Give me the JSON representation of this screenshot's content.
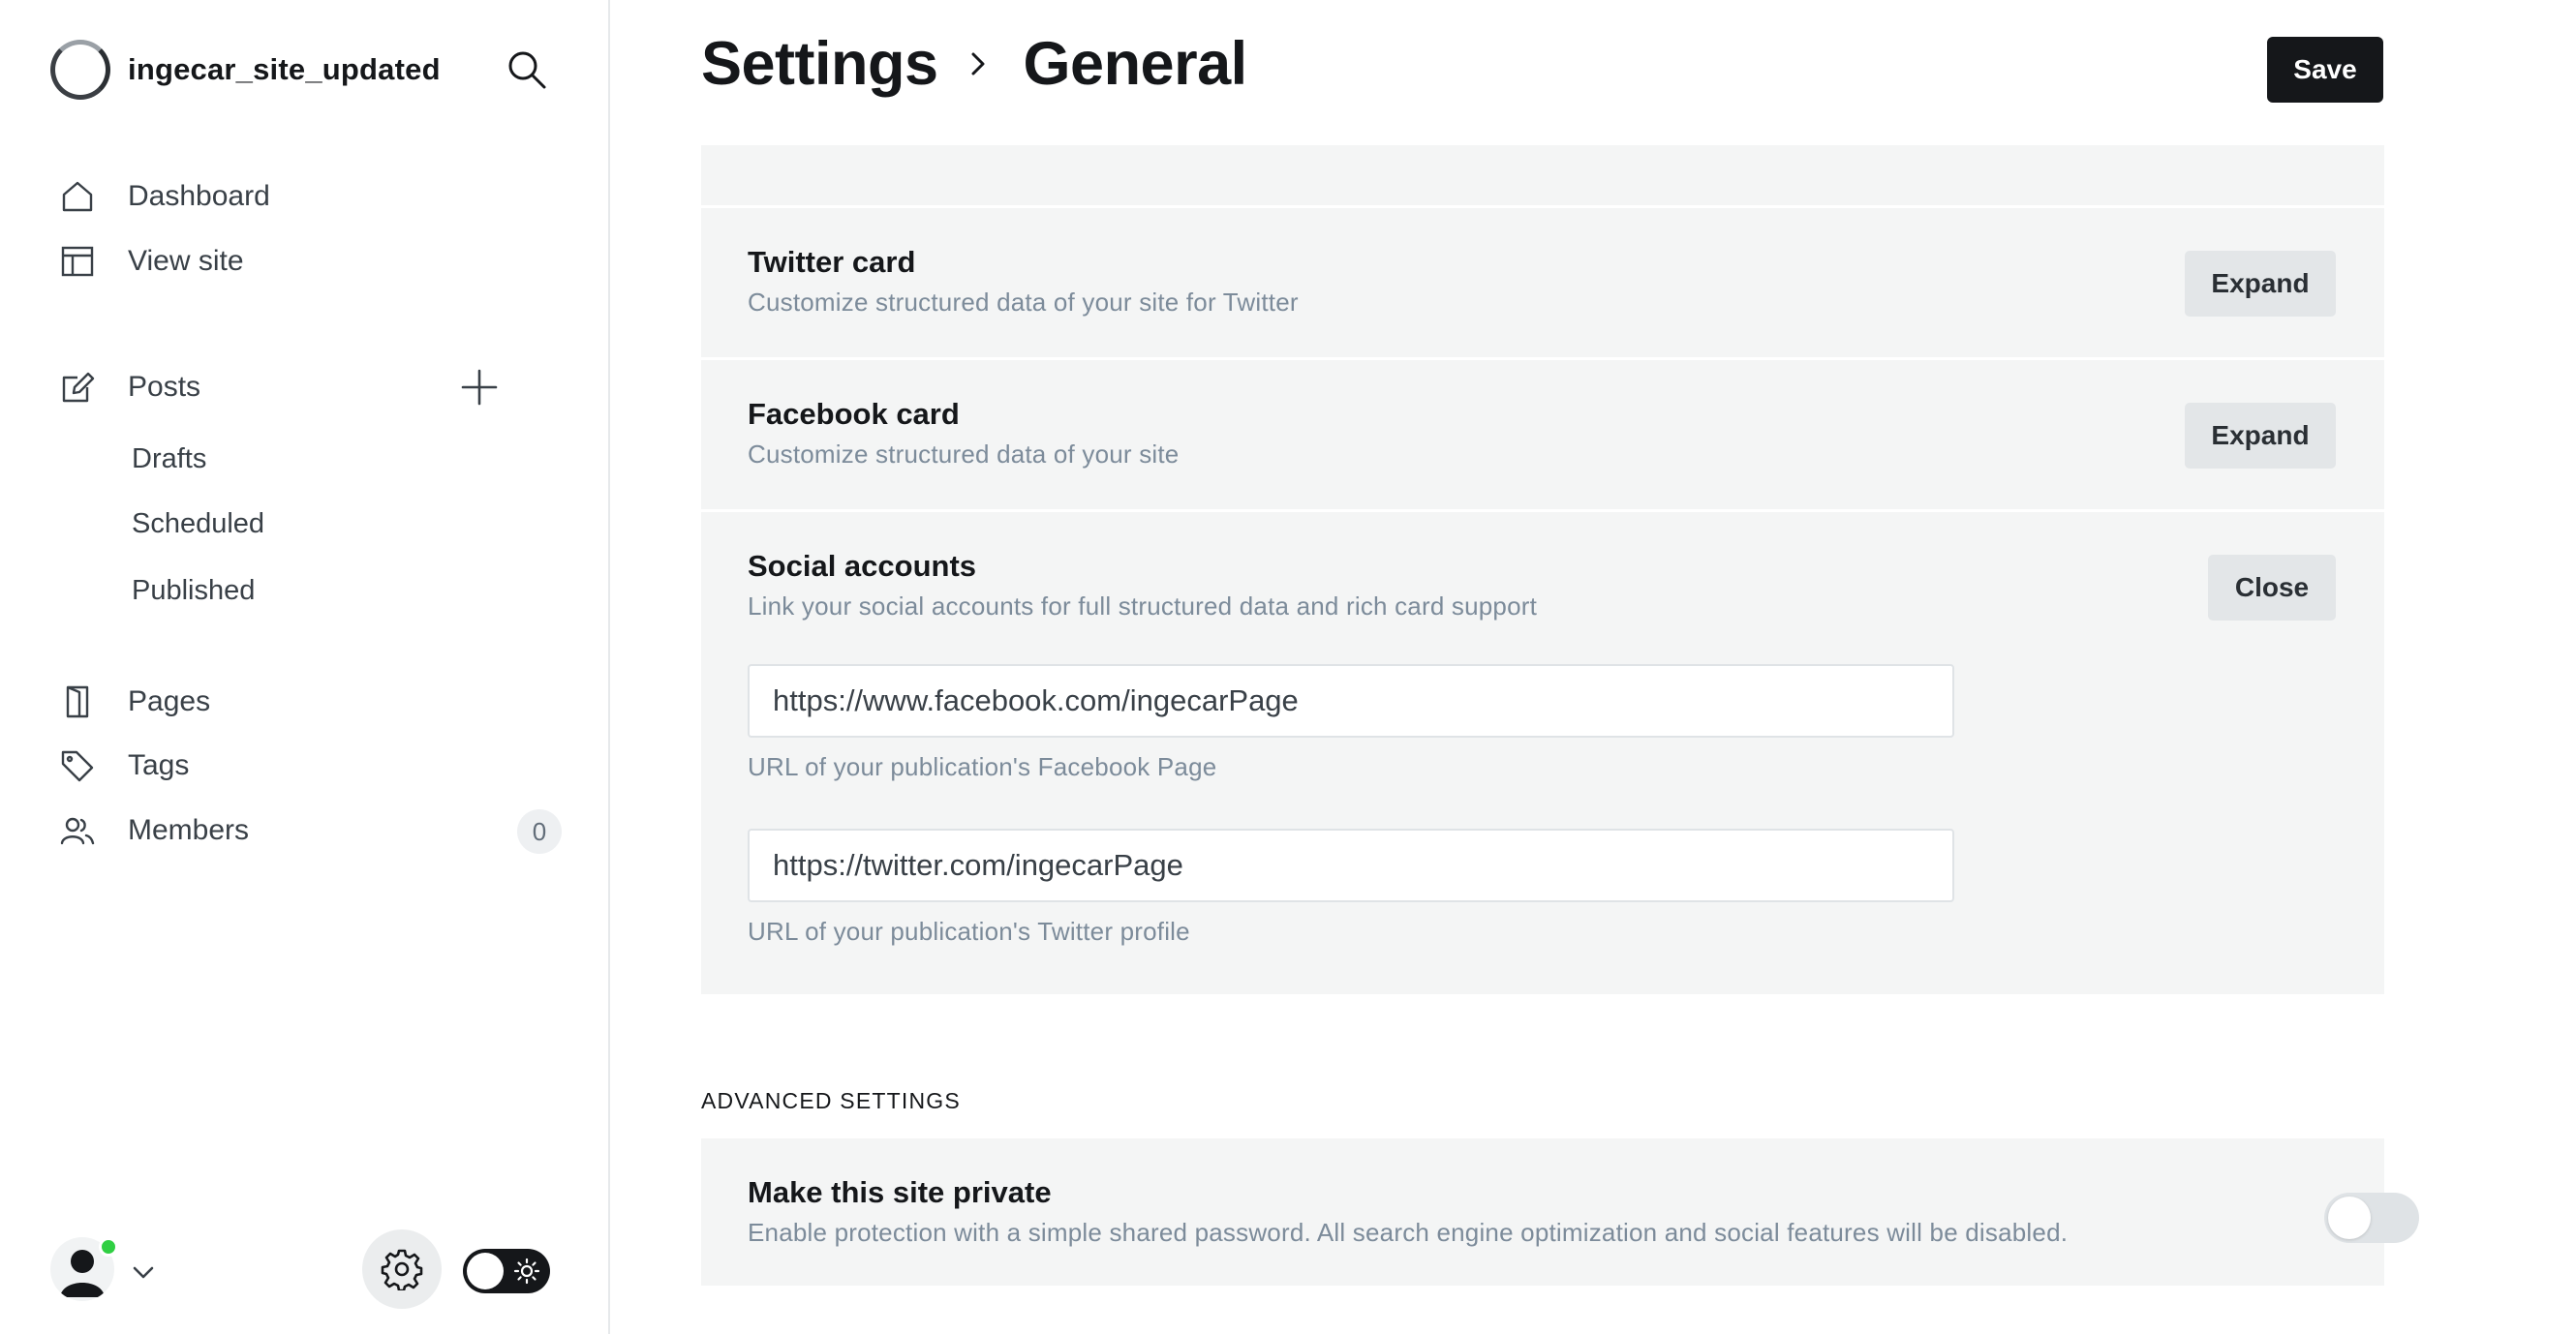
{
  "sidebar": {
    "site_name": "ingecar_site_updated",
    "nav": {
      "dashboard": "Dashboard",
      "view_site": "View site",
      "posts": "Posts",
      "drafts": "Drafts",
      "scheduled": "Scheduled",
      "published": "Published",
      "pages": "Pages",
      "tags": "Tags",
      "members": "Members",
      "members_count": "0"
    },
    "icons": {
      "search": "search-icon",
      "dashboard": "home-icon",
      "view_site": "layout-icon",
      "posts": "edit-icon",
      "new_post": "plus-icon",
      "pages": "page-icon",
      "tags": "tag-icon",
      "members": "users-icon",
      "settings": "gear-icon",
      "theme": "sun-icon"
    }
  },
  "header": {
    "breadcrumb_parent": "Settings",
    "breadcrumb_current": "General",
    "save_label": "Save"
  },
  "sections": {
    "twitter_card": {
      "title": "Twitter card",
      "description": "Customize structured data of your site for Twitter",
      "button": "Expand"
    },
    "facebook_card": {
      "title": "Facebook card",
      "description": "Customize structured data of your site",
      "button": "Expand"
    },
    "social_accounts": {
      "title": "Social accounts",
      "description": "Link your social accounts for full structured data and rich card support",
      "button": "Close",
      "facebook_url": "https://www.facebook.com/ingecarPage",
      "facebook_hint": "URL of your publication's Facebook Page",
      "twitter_url": "https://twitter.com/ingecarPage",
      "twitter_hint": "URL of your publication's Twitter profile"
    },
    "advanced_label": "ADVANCED SETTINGS",
    "private_site": {
      "title": "Make this site private",
      "description": "Enable protection with a simple shared password. All search engine optimization and social features will be disabled.",
      "enabled": false
    }
  },
  "colors": {
    "primary": "#15171a",
    "panel_bg": "#f4f5f5",
    "muted_text": "#7c8b9a",
    "online_dot": "#30cf43"
  }
}
